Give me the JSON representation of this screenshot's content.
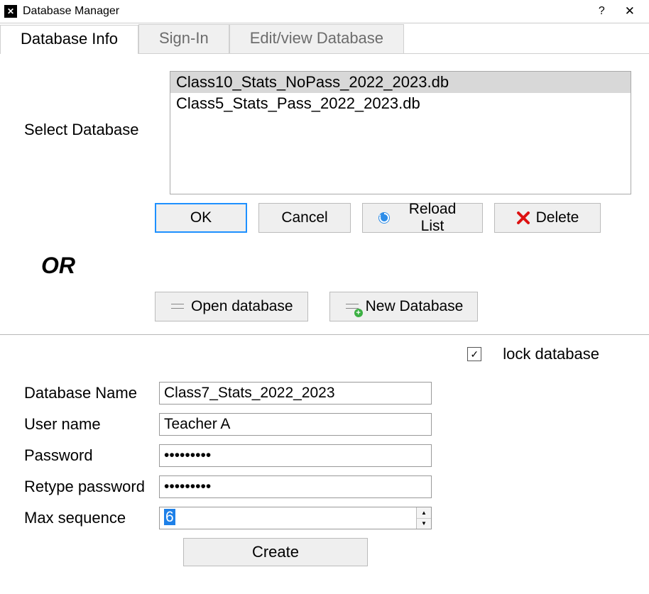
{
  "window": {
    "title": "Database Manager"
  },
  "tabs": [
    {
      "label": "Database Info",
      "active": true
    },
    {
      "label": "Sign-In",
      "active": false
    },
    {
      "label": "Edit/view Database",
      "active": false
    }
  ],
  "selectDB": {
    "label": "Select Database",
    "items": [
      {
        "name": "Class10_Stats_NoPass_2022_2023.db",
        "selected": true
      },
      {
        "name": "Class5_Stats_Pass_2022_2023.db",
        "selected": false
      }
    ]
  },
  "buttons": {
    "ok": "OK",
    "cancel": "Cancel",
    "reload": "Reload List",
    "delete": "Delete"
  },
  "orLabel": "OR",
  "open": "Open database",
  "newdb": "New Database",
  "lock": {
    "label": "lock database",
    "checked": true
  },
  "form": {
    "dbname": {
      "label": "Database Name",
      "value": "Class7_Stats_2022_2023"
    },
    "username": {
      "label": "User name",
      "value": "Teacher A"
    },
    "password": {
      "label": "Password",
      "value": "•••••••••"
    },
    "retype": {
      "label": "Retype password",
      "value": "•••••••••"
    },
    "maxseq": {
      "label": "Max sequence",
      "value": "6"
    }
  },
  "create": "Create"
}
